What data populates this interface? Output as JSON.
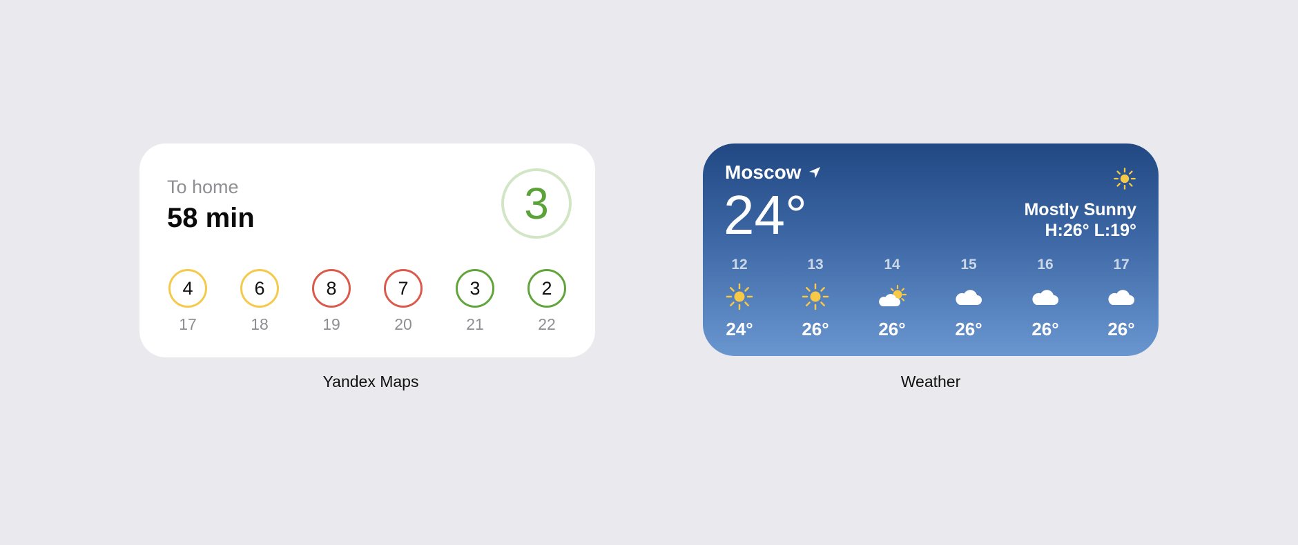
{
  "yandex_maps": {
    "caption": "Yandex Maps",
    "subtitle": "To home",
    "travel_time": "58 min",
    "traffic_level": "3",
    "forecast": [
      {
        "level": "4",
        "hour": "17",
        "color": "#f5c94a"
      },
      {
        "level": "6",
        "hour": "18",
        "color": "#f5c94a"
      },
      {
        "level": "8",
        "hour": "19",
        "color": "#dc5a4c"
      },
      {
        "level": "7",
        "hour": "20",
        "color": "#dc5a4c"
      },
      {
        "level": "3",
        "hour": "21",
        "color": "#62a43c"
      },
      {
        "level": "2",
        "hour": "22",
        "color": "#62a43c"
      }
    ]
  },
  "weather": {
    "caption": "Weather",
    "city": "Moscow",
    "temperature": "24°",
    "condition": "Mostly Sunny",
    "high_low": "H:26° L:19°",
    "condition_icon": "sun-icon",
    "hourly": [
      {
        "hour": "12",
        "icon": "sun-icon",
        "temp": "24°"
      },
      {
        "hour": "13",
        "icon": "sun-icon",
        "temp": "26°"
      },
      {
        "hour": "14",
        "icon": "partly-cloudy-icon",
        "temp": "26°"
      },
      {
        "hour": "15",
        "icon": "cloud-icon",
        "temp": "26°"
      },
      {
        "hour": "16",
        "icon": "cloud-icon",
        "temp": "26°"
      },
      {
        "hour": "17",
        "icon": "cloud-icon",
        "temp": "26°"
      }
    ]
  },
  "colors": {
    "background": "#eae9ee",
    "traffic_yellow": "#f5c94a",
    "traffic_red": "#dc5a4c",
    "traffic_green": "#62a43c",
    "sun": "#f7c947"
  }
}
